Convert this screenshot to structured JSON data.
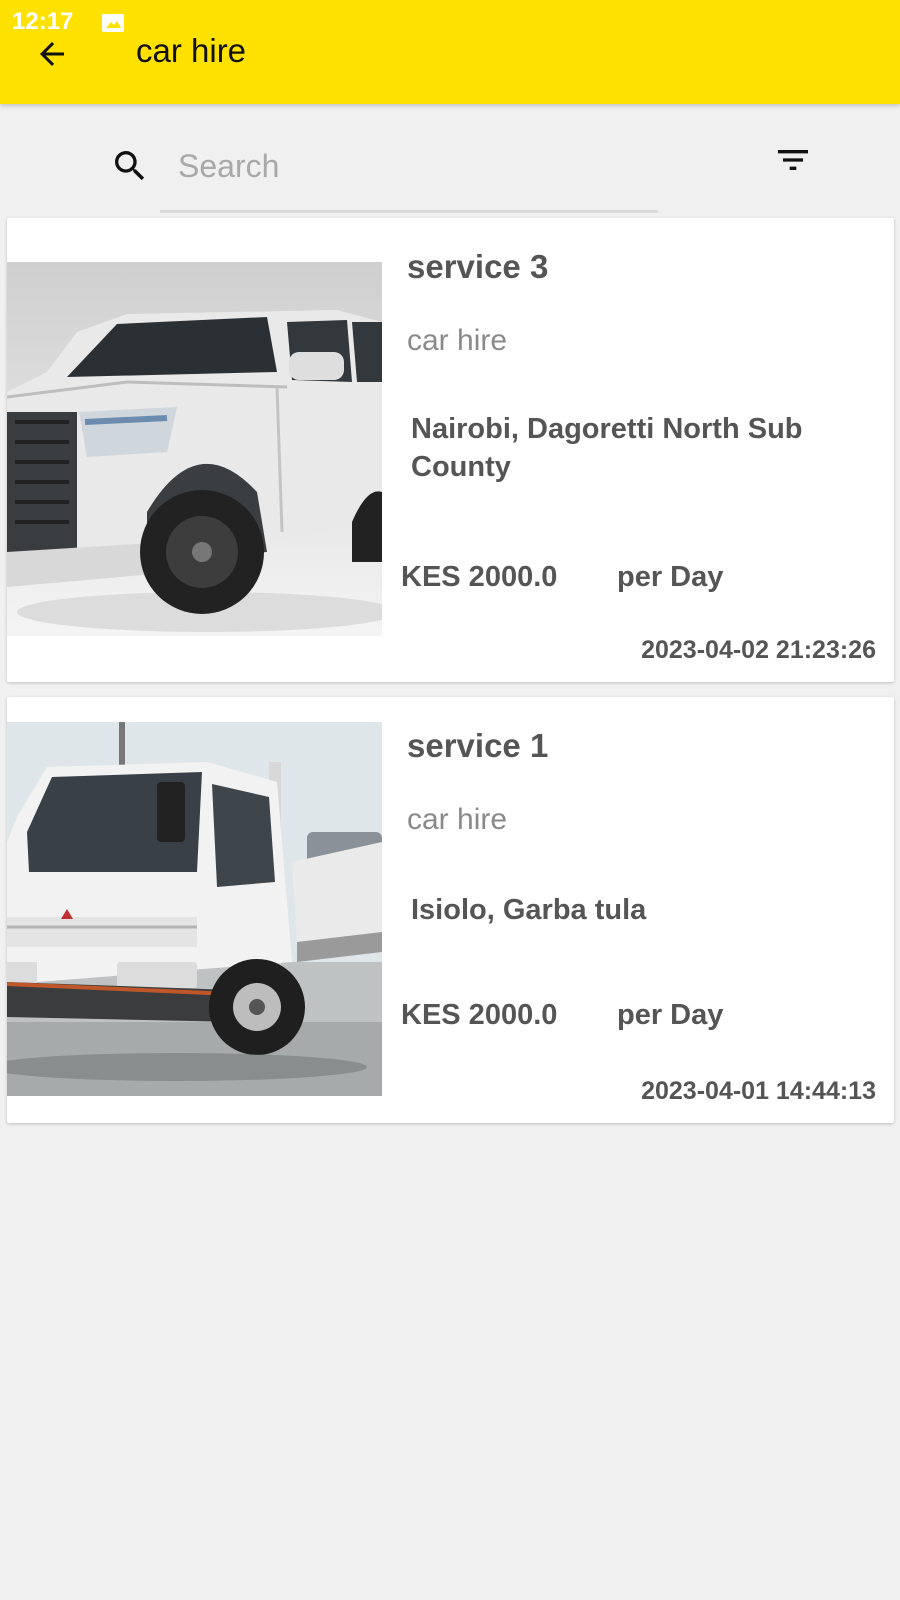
{
  "status_bar": {
    "time": "12:17",
    "notification_icon": "image-icon"
  },
  "appbar": {
    "back_icon": "arrow-left-icon",
    "title": "car hire",
    "color": "#ffe100"
  },
  "search": {
    "placeholder": "Search",
    "value": "",
    "search_icon": "search-icon",
    "filter_icon": "filter-icon"
  },
  "listings": [
    {
      "name": "service 3",
      "category": "car hire",
      "location": "Nairobi, Dagoretti North Sub County",
      "price": "KES 2000.0",
      "unit": "per Day",
      "date": "2023-04-02 21:23:26",
      "image": "white pickup truck"
    },
    {
      "name": "service 1",
      "category": "car hire",
      "location": "Isiolo, Garba tula",
      "price": "KES 2000.0",
      "unit": "per Day",
      "date": "2023-04-01 14:44:13",
      "image": "white flatbed lorry"
    }
  ]
}
